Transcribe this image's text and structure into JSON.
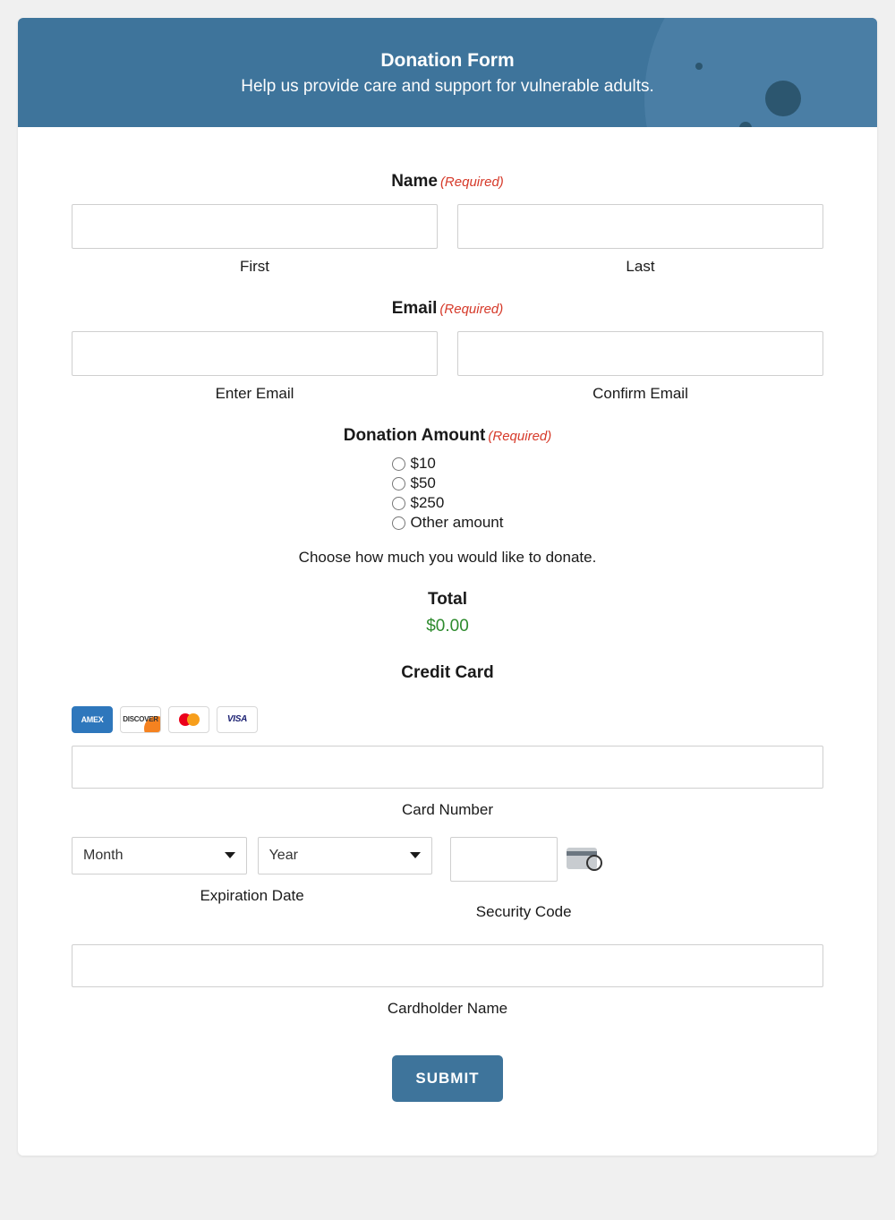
{
  "header": {
    "title": "Donation Form",
    "subtitle": "Help us provide care and support for vulnerable adults."
  },
  "required_text": "(Required)",
  "name": {
    "label": "Name",
    "first_label": "First",
    "last_label": "Last",
    "first_value": "",
    "last_value": ""
  },
  "email": {
    "label": "Email",
    "enter_label": "Enter Email",
    "confirm_label": "Confirm Email",
    "enter_value": "",
    "confirm_value": ""
  },
  "donation": {
    "label": "Donation Amount",
    "options": [
      "$10",
      "$50",
      "$250",
      "Other amount"
    ],
    "helper": "Choose how much you would like to donate."
  },
  "total": {
    "label": "Total",
    "value": "$0.00"
  },
  "credit_card": {
    "label": "Credit Card",
    "brands": {
      "amex": "AMEX",
      "discover": "DISCOVER",
      "visa": "VISA"
    },
    "card_number_label": "Card Number",
    "card_number_value": "",
    "exp_label": "Expiration Date",
    "month_text": "Month",
    "year_text": "Year",
    "security_label": "Security Code",
    "security_value": "",
    "cardholder_label": "Cardholder Name",
    "cardholder_value": ""
  },
  "submit_label": "SUBMIT"
}
